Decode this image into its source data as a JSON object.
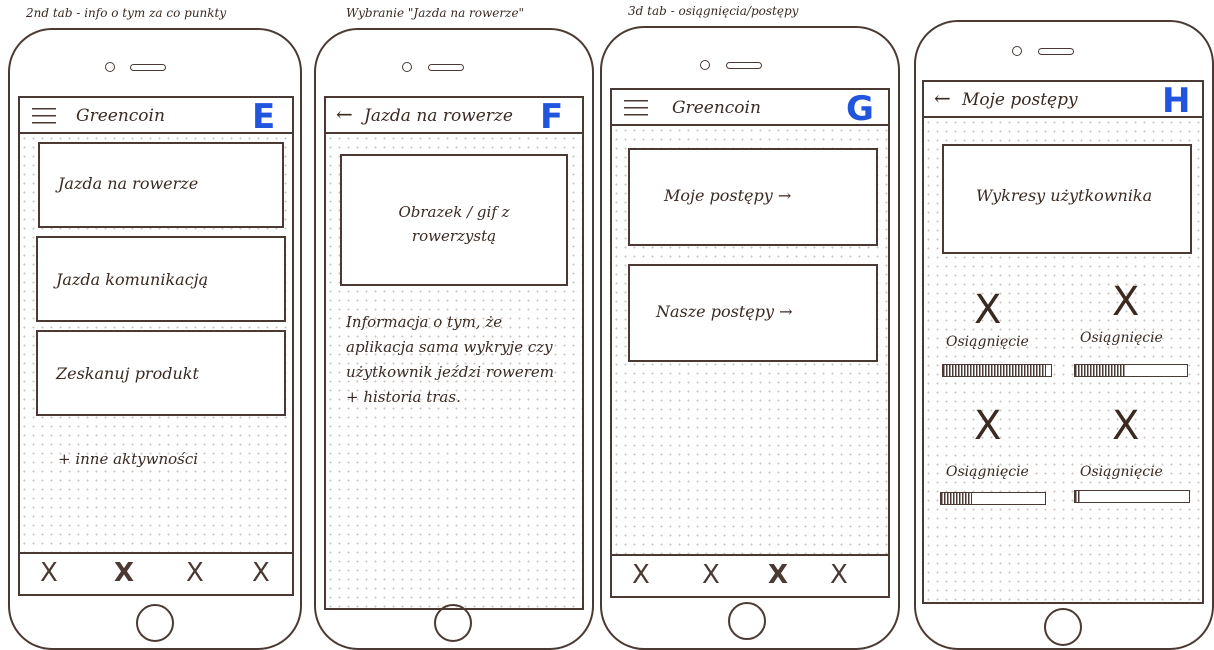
{
  "captions": {
    "e": "2nd tab - info o tym za co punkty",
    "f": "Wybranie \"Jazda na rowerze\"",
    "g": "3d tab - osiągnięcia/postępy"
  },
  "accent_color": "#2255dd",
  "screens": {
    "e": {
      "letter": "E",
      "header_title": "Greencoin",
      "cards": [
        "Jazda na rowerze",
        "Jazda komunikacją",
        "Zeskanuj produkt"
      ],
      "footer_note": "+ inne aktywności"
    },
    "f": {
      "letter": "F",
      "header_title": "Jazda na rowerze",
      "media_placeholder": "Obrazek / gif z rowerzystą",
      "info_text": "Informacja o tym, że aplikacja sama wykryje czy użytkownik jeździ rowerem + historia tras."
    },
    "g": {
      "letter": "G",
      "header_title": "Greencoin",
      "cards": [
        "Moje postępy →",
        "Nasze postępy →"
      ]
    },
    "h": {
      "letter": "H",
      "header_title": "Moje postępy",
      "chart_placeholder": "Wykresy użytkownika",
      "achievements": [
        {
          "label": "Osiągnięcie",
          "progress": 0.95
        },
        {
          "label": "Osiągnięcie",
          "progress": 0.45
        },
        {
          "label": "Osiągnięcie",
          "progress": 0.3
        },
        {
          "label": "Osiągnięcie",
          "progress": 0.05
        }
      ]
    }
  },
  "icons": {
    "nav_tab": "x-icon",
    "achievement": "x-icon",
    "menu": "hamburger-icon",
    "back": "arrow-left-icon"
  },
  "nav_glyph": "X",
  "back_glyph": "←"
}
